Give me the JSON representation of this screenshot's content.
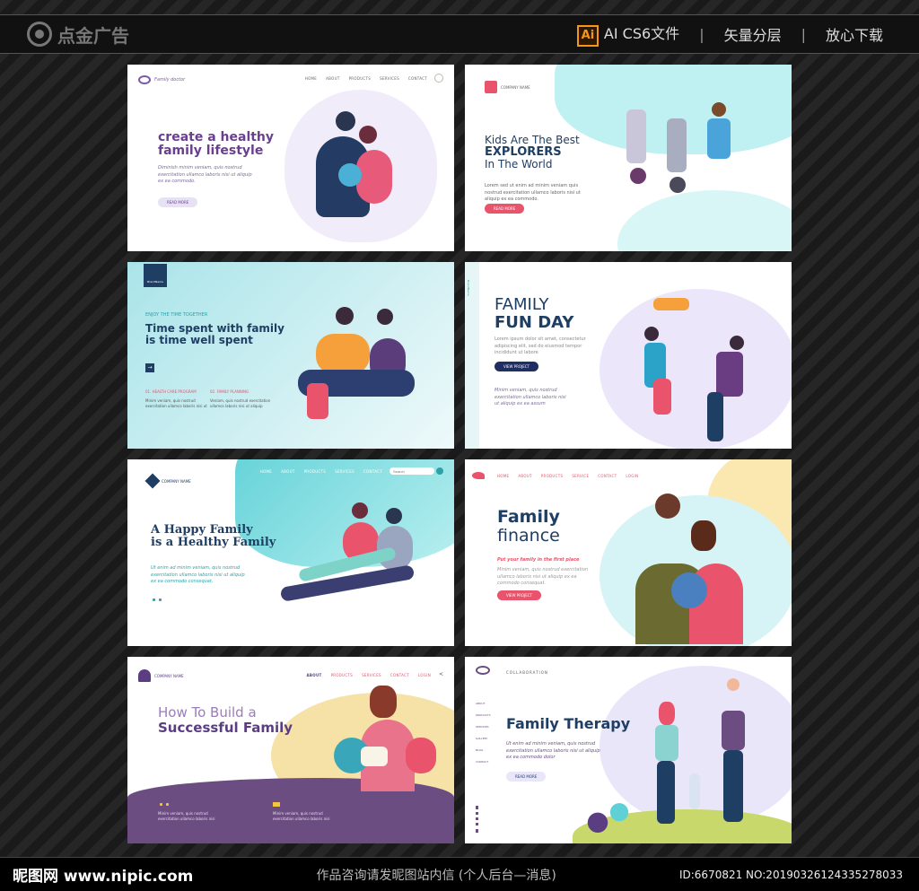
{
  "topbar": {
    "logo_text": "点金广告",
    "ai_badge": "Ai",
    "format_label": "AI CS6文件",
    "sep1": "|",
    "feature1": "矢量分层",
    "sep2": "|",
    "feature2": "放心下载"
  },
  "cards": {
    "c1": {
      "brand": "Family doctor",
      "nav": [
        "HOME",
        "ABOUT",
        "PRODUCTS",
        "SERVICES",
        "CONTACT"
      ],
      "title_line1": "create a healthy",
      "title_line2": "family lifestyle",
      "body": "Diminish minim veniam, quis nostrud exercitation ullamco laboris nisi ut aliquip ex ea commodo.",
      "button": "READ MORE"
    },
    "c2": {
      "brand": "COMPANY NAME",
      "line1": "Kids Are The Best",
      "line2": "EXPLORERS",
      "line3": "In The World",
      "body": "Lorem sed ut enim ad minim veniam quis nostrud exercitation ullamco laboris nisi ut aliquip ex ea commodo.",
      "button": "READ MORE"
    },
    "c3": {
      "brand": "BrandName",
      "kicker": "ENJOY THE TIME TOGETHER",
      "title_line1": "Time spent with family",
      "title_line2": "is time well spent",
      "col1_title": "01. HEALTH CARE PROGRAM",
      "col1_body": "Minim veniam, quis nostrud exercitation ullamco laboris nisi ut",
      "col2_title": "02. FAMILY PLANNING",
      "col2_body": "Veniam, quis nostrud exercitation ullamco laboris nisi ut aliquip"
    },
    "c4": {
      "side_label": "BrandName",
      "title_line1": "FAMILY",
      "title_line2": "FUN DAY",
      "body": "Lorem ipsum dolor sit amet, consectetur adipiscing elit, sed do eiusmod tempor incididunt ut labore",
      "button": "VIEW PROJECT",
      "footer": "Minim veniam, quis nostrud exercitation ullamco laboris nisi ut aliquip ex ea assum"
    },
    "c5": {
      "brand": "COMPANY NAME",
      "nav": [
        "HOME",
        "ABOUT",
        "PRODUCTS",
        "SERVICES",
        "CONTACT"
      ],
      "search_placeholder": "Search",
      "title_line1": "A Happy Family",
      "title_line2": "is a Healthy Family",
      "body": "Ut enim ad minim veniam, quis nostrud exercitation ullamco laboris nisi ut aliquip ex ea commodo consequat."
    },
    "c6": {
      "nav": [
        "HOME",
        "ABOUT",
        "PRODUCTS",
        "SERVICE",
        "CONTACT",
        "LOGIN"
      ],
      "title_line1": "Family",
      "title_line2": "finance",
      "kicker": "Put your family in the first place",
      "body": "Minim veniam, quis nostrud exercitation ullamco laboris nisi ut aliquip ex ea commodo consequat.",
      "button": "VIEW PROJECT"
    },
    "c7": {
      "brand": "COMPANY NAME",
      "nav": [
        "ABOUT",
        "PRODUCTS",
        "SERVICES",
        "CONTACT",
        "LOGIN"
      ],
      "title_line1": "How To Build a",
      "title_line2": "Successful Family",
      "col1_body": "Minim veniam, quis nostrud exercitation ullamco laboris nisi",
      "col2_body": "Minim veniam, quis nostrud exercitation ullamco laboris nisi"
    },
    "c8": {
      "brand": "COLLABORATION",
      "side_nav": [
        "ABOUT",
        "PRODUCTS",
        "SERVICES",
        "GALLERY",
        "BLOG",
        "CONTACT"
      ],
      "title": "Family Therapy",
      "body": "Ut enim ad minim veniam, quis nostrud exercitation ullamco laboris nisi ut aliquip ex ea commodo dolor",
      "button": "READ MORE"
    }
  },
  "bottombar": {
    "brand": "昵图网 www.nipic.com",
    "notice": "作品咨询请发昵图站内信 (个人后台—消息)",
    "id_text": "ID:6670821 NO:20190326124335278033"
  },
  "colors": {
    "purple": "#5b3d82",
    "navy": "#1f3e63",
    "teal": "#5fd1d6",
    "pink": "#e9536b"
  }
}
